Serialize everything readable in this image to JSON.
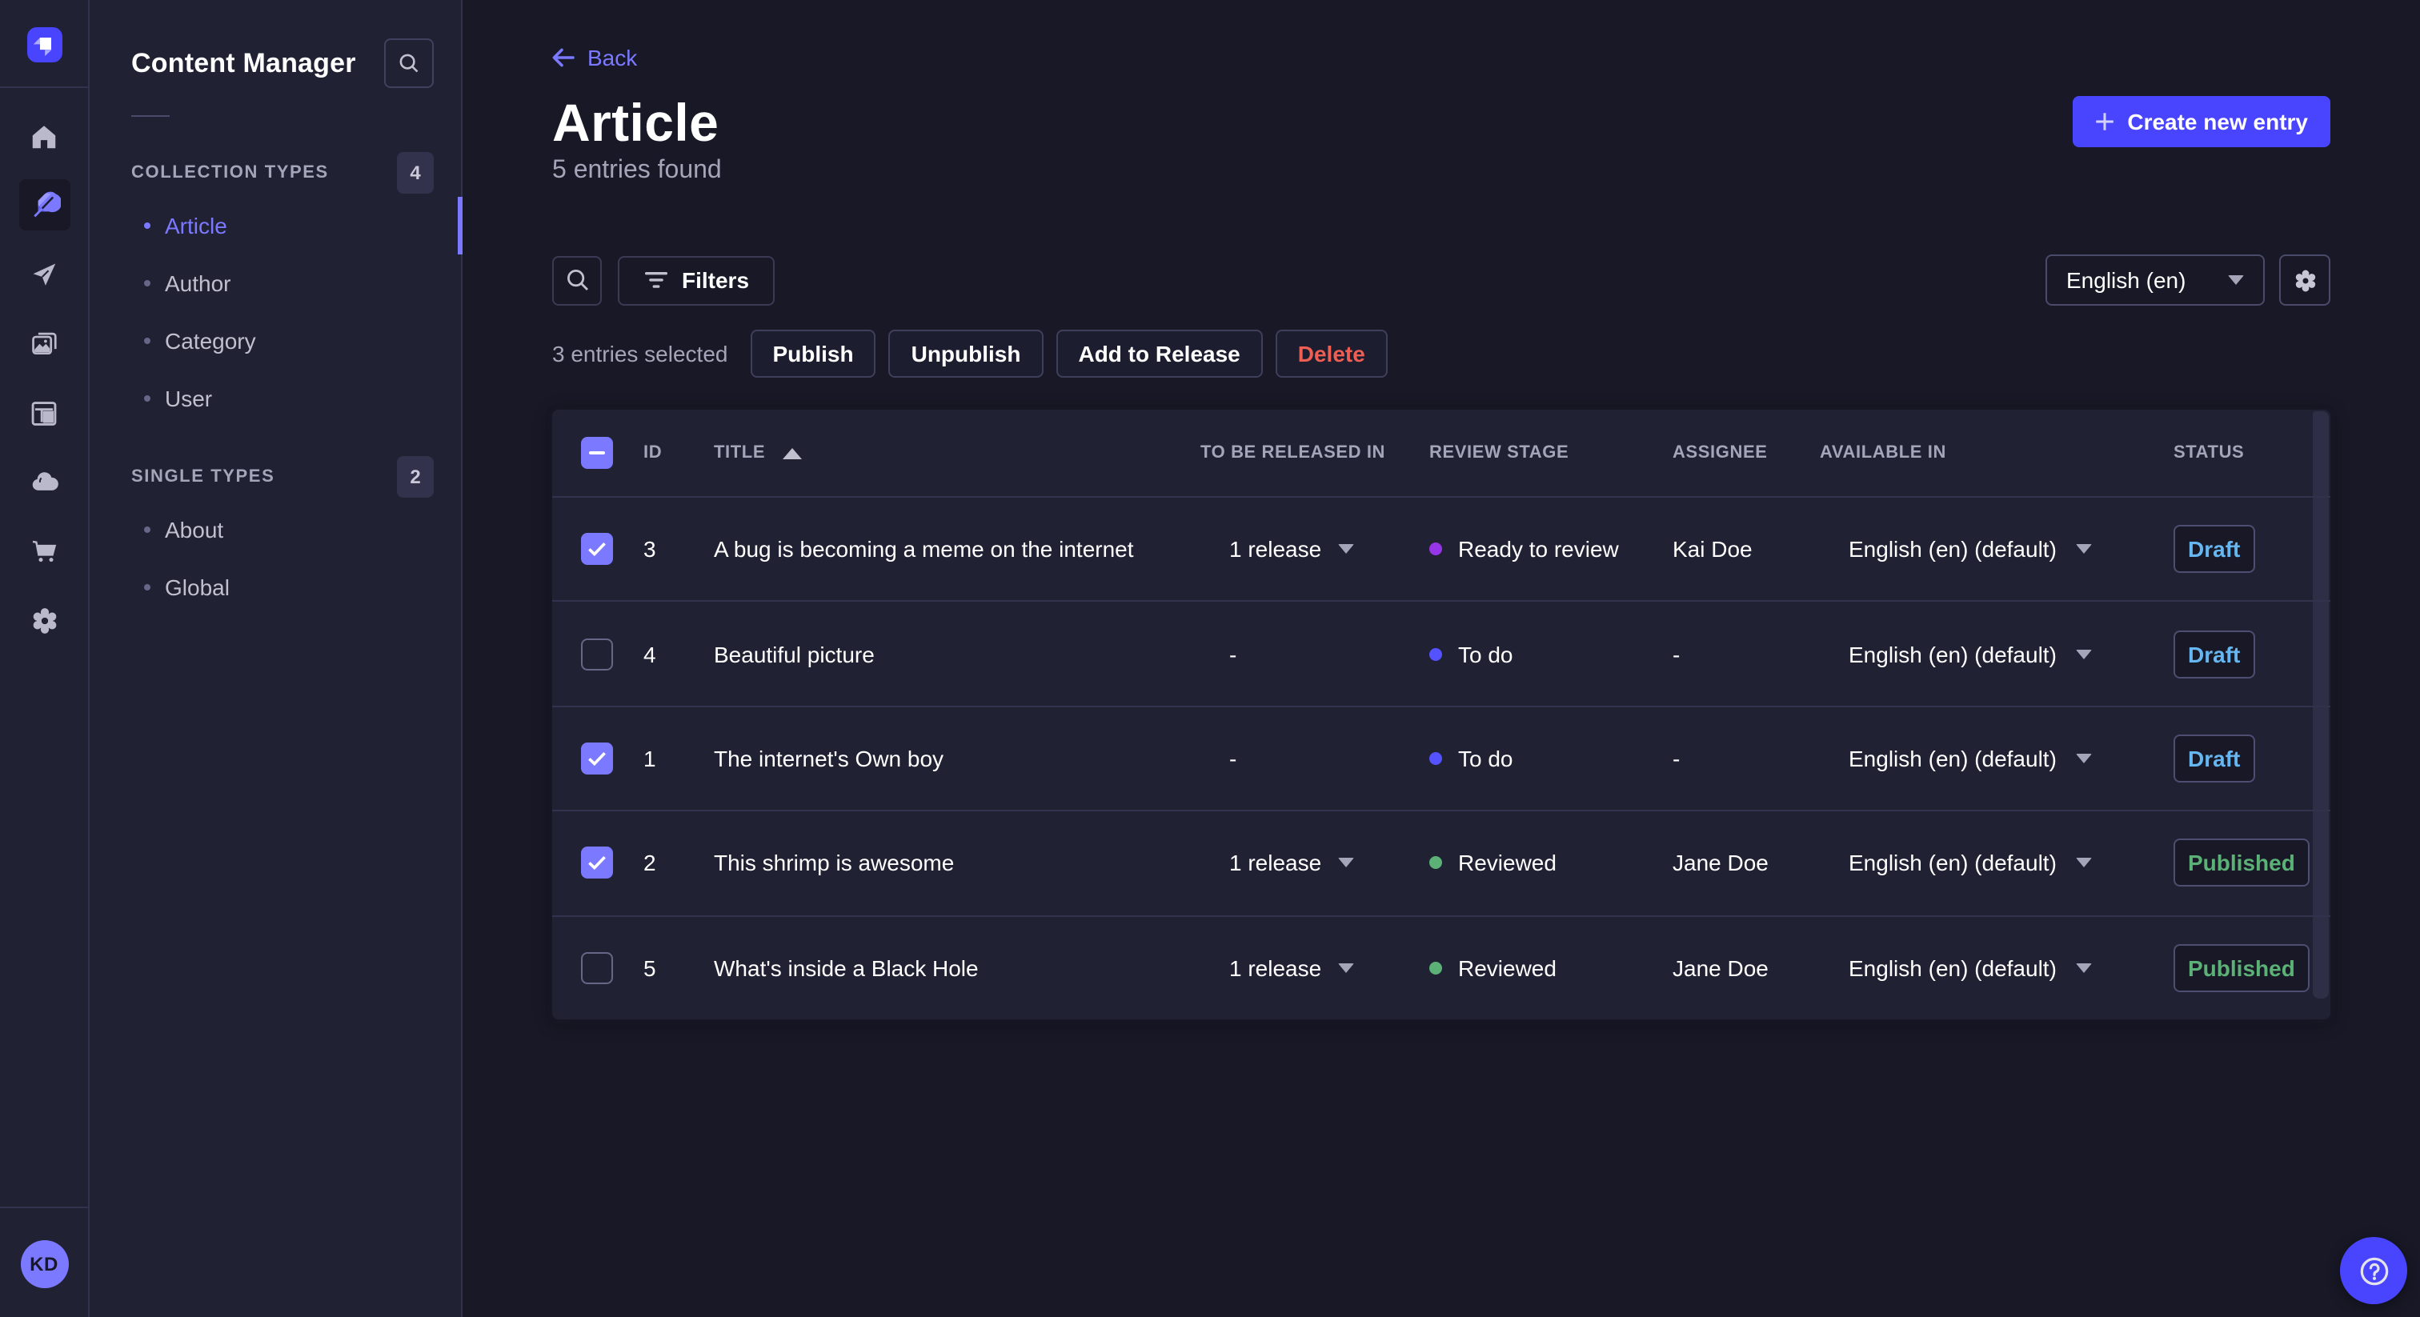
{
  "nav": {
    "logo_color": "#4945ff",
    "items": [
      {
        "name": "home",
        "active": false
      },
      {
        "name": "content-manager",
        "active": true
      },
      {
        "name": "releases",
        "active": false
      },
      {
        "name": "media-library",
        "active": false
      },
      {
        "name": "content-type-builder",
        "active": false
      },
      {
        "name": "deploy",
        "active": false
      },
      {
        "name": "marketplace",
        "active": false
      },
      {
        "name": "settings",
        "active": false
      }
    ],
    "avatar_initials": "KD"
  },
  "subnav": {
    "title": "Content Manager",
    "sections": [
      {
        "label": "COLLECTION TYPES",
        "badge": "4",
        "items": [
          {
            "label": "Article",
            "active": true
          },
          {
            "label": "Author",
            "active": false
          },
          {
            "label": "Category",
            "active": false
          },
          {
            "label": "User",
            "active": false
          }
        ]
      },
      {
        "label": "SINGLE TYPES",
        "badge": "2",
        "items": [
          {
            "label": "About",
            "active": false
          },
          {
            "label": "Global",
            "active": false
          }
        ]
      }
    ]
  },
  "header": {
    "back_label": "Back",
    "title": "Article",
    "subtitle": "5 entries found",
    "create_label": "Create new entry"
  },
  "toolbar": {
    "filters_label": "Filters",
    "locale_value": "English (en)"
  },
  "selection": {
    "text": "3 entries selected",
    "publish_label": "Publish",
    "unpublish_label": "Unpublish",
    "add_to_release_label": "Add to Release",
    "delete_label": "Delete"
  },
  "table": {
    "columns": {
      "id": "ID",
      "title": "TITLE",
      "released_in": "TO BE RELEASED IN",
      "review_stage": "REVIEW STAGE",
      "assignee": "ASSIGNEE",
      "available_in": "AVAILABLE IN",
      "status": "STATUS"
    },
    "sort": {
      "column": "TITLE",
      "direction": "ascending"
    },
    "select_all_state": "indeterminate",
    "stage_colors": {
      "To do": "#5552ff",
      "Ready to review": "#9736e8",
      "Reviewed": "#5cb176"
    },
    "status_colors": {
      "Draft": "#66b7f1",
      "Published": "#5cb176"
    },
    "rows": [
      {
        "checked": true,
        "id": "3",
        "title": "A bug is becoming a meme on the internet",
        "released_in": "1 release",
        "review_stage": "Ready to review",
        "stage_color": "#9736e8",
        "assignee": "Kai Doe",
        "available_in": "English (en) (default)",
        "status": "Draft"
      },
      {
        "checked": false,
        "id": "4",
        "title": "Beautiful picture",
        "released_in": "-",
        "review_stage": "To do",
        "stage_color": "#5552ff",
        "assignee": "-",
        "available_in": "English (en) (default)",
        "status": "Draft"
      },
      {
        "checked": true,
        "id": "1",
        "title": "The internet's Own boy",
        "released_in": "-",
        "review_stage": "To do",
        "stage_color": "#5552ff",
        "assignee": "-",
        "available_in": "English (en) (default)",
        "status": "Draft"
      },
      {
        "checked": true,
        "id": "2",
        "title": "This shrimp is awesome",
        "released_in": "1 release",
        "review_stage": "Reviewed",
        "stage_color": "#5cb176",
        "assignee": "Jane Doe",
        "available_in": "English (en) (default)",
        "status": "Published"
      },
      {
        "checked": false,
        "id": "5",
        "title": "What's inside a Black Hole",
        "released_in": "1 release",
        "review_stage": "Reviewed",
        "stage_color": "#5cb176",
        "assignee": "Jane Doe",
        "available_in": "English (en) (default)",
        "status": "Published"
      }
    ]
  },
  "help": {
    "icon": "question-mark"
  }
}
